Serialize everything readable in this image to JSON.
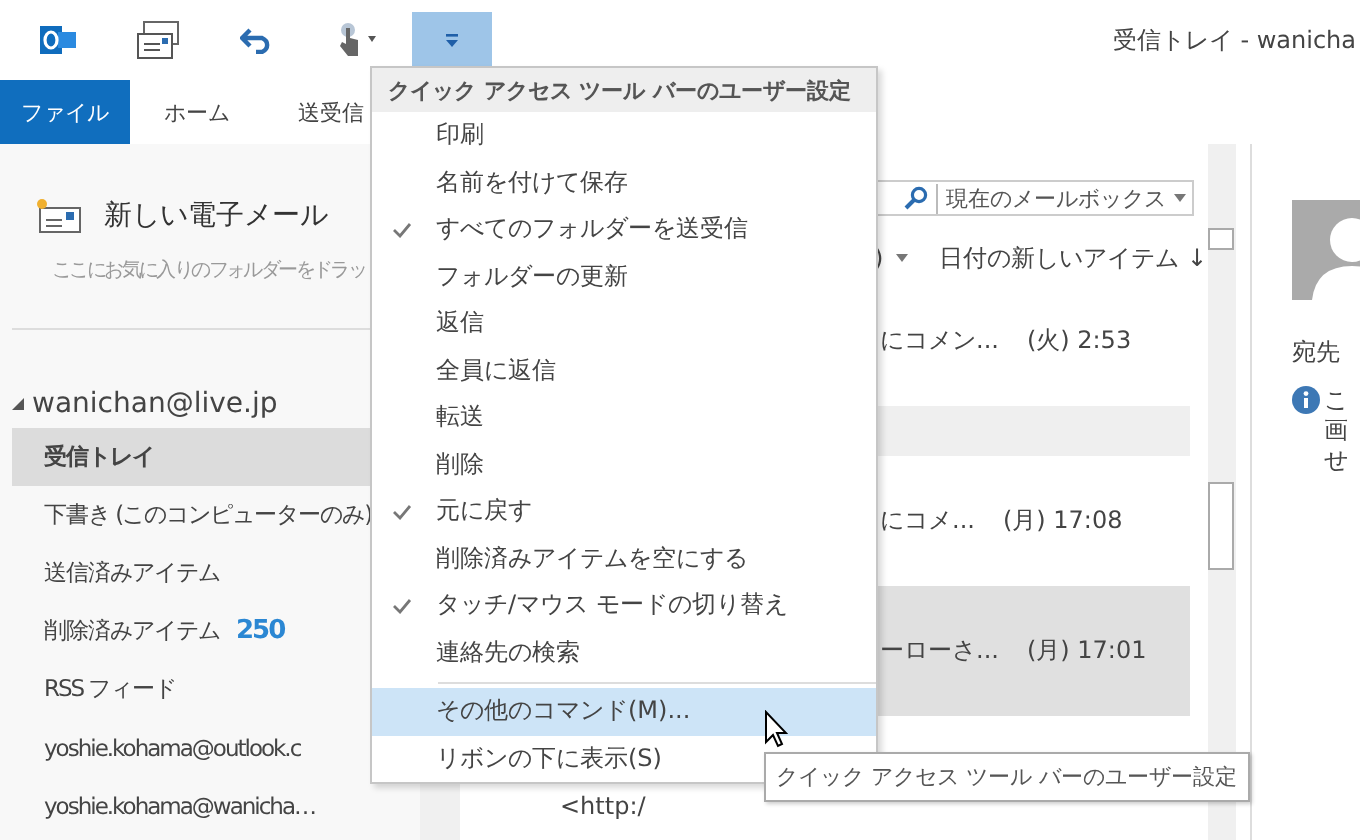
{
  "qat": [
    {
      "kind": "outlook",
      "selected": false
    },
    {
      "kind": "sendreceive",
      "selected": false
    },
    {
      "kind": "undo",
      "selected": false
    },
    {
      "kind": "touch",
      "selected": false
    },
    {
      "kind": "customize",
      "selected": true
    }
  ],
  "window": {
    "title": "受信トレイ - wanicha"
  },
  "ribbon_tabs": [
    {
      "label": "ファイル",
      "kind": "file"
    },
    {
      "label": "ホーム",
      "kind": "tab"
    },
    {
      "label": "送受信",
      "kind": "tab"
    }
  ],
  "nav": {
    "new_mail": "新しい電子メール",
    "favorites_hint": "ここにお気に入りのフォルダーをドラッ",
    "account": "wanichan@live.jp",
    "folders": [
      {
        "name": "受信トレイ",
        "selected": true
      },
      {
        "name": "下書き (このコンピューターのみ)",
        "selected": false
      },
      {
        "name": "送信済みアイテム",
        "selected": false
      },
      {
        "name": "削除済みアイテム",
        "count": "250",
        "selected": false
      },
      {
        "name": "RSS フィード",
        "selected": false
      },
      {
        "name": "yoshie.kohama@outlook.c",
        "selected": false
      },
      {
        "name": "yoshie.kohama@wanicha…",
        "selected": false
      }
    ]
  },
  "search": {
    "scope": "現在のメールボックス"
  },
  "sort": {
    "filter": ")",
    "order": "日付の新しいアイテム ↓"
  },
  "messages": [
    {
      "kind": "message",
      "subject": "にコメン...",
      "date": "(火) 2:53",
      "selected": false
    },
    {
      "kind": "group"
    },
    {
      "kind": "message",
      "subject": "にコメ...",
      "date": "(月) 17:08",
      "selected": false
    },
    {
      "kind": "message",
      "subject": "ーローさ...",
      "date": "(月) 17:01",
      "selected": true
    },
    {
      "kind": "preview",
      "text": "<http:/"
    }
  ],
  "reading": {
    "to_label": "宛先",
    "info_lines": [
      "こ",
      "画",
      "せ"
    ]
  },
  "menu": {
    "title": "クイック アクセス ツール バーのユーザー設定",
    "items": [
      {
        "kind": "item",
        "label": "印刷",
        "checked": false,
        "selected": false
      },
      {
        "kind": "item",
        "label": "名前を付けて保存",
        "checked": false,
        "selected": false
      },
      {
        "kind": "item",
        "label": "すべてのフォルダーを送受信",
        "checked": true,
        "selected": false
      },
      {
        "kind": "item",
        "label": "フォルダーの更新",
        "checked": false,
        "selected": false
      },
      {
        "kind": "item",
        "label": "返信",
        "checked": false,
        "selected": false
      },
      {
        "kind": "item",
        "label": "全員に返信",
        "checked": false,
        "selected": false
      },
      {
        "kind": "item",
        "label": "転送",
        "checked": false,
        "selected": false
      },
      {
        "kind": "item",
        "label": "削除",
        "checked": false,
        "selected": false
      },
      {
        "kind": "item",
        "label": "元に戻す",
        "checked": true,
        "selected": false
      },
      {
        "kind": "item",
        "label": "削除済みアイテムを空にする",
        "checked": false,
        "selected": false
      },
      {
        "kind": "item",
        "label": "タッチ/マウス モードの切り替え",
        "checked": true,
        "selected": false
      },
      {
        "kind": "item",
        "label": "連絡先の検索",
        "checked": false,
        "selected": false
      },
      {
        "kind": "separator"
      },
      {
        "kind": "item",
        "label": "その他のコマンド(M)...",
        "checked": false,
        "selected": true
      },
      {
        "kind": "item",
        "label": "リボンの下に表示(S)",
        "checked": false,
        "selected": false
      }
    ],
    "tooltip": "クイック アクセス ツール バーのユーザー設定"
  }
}
